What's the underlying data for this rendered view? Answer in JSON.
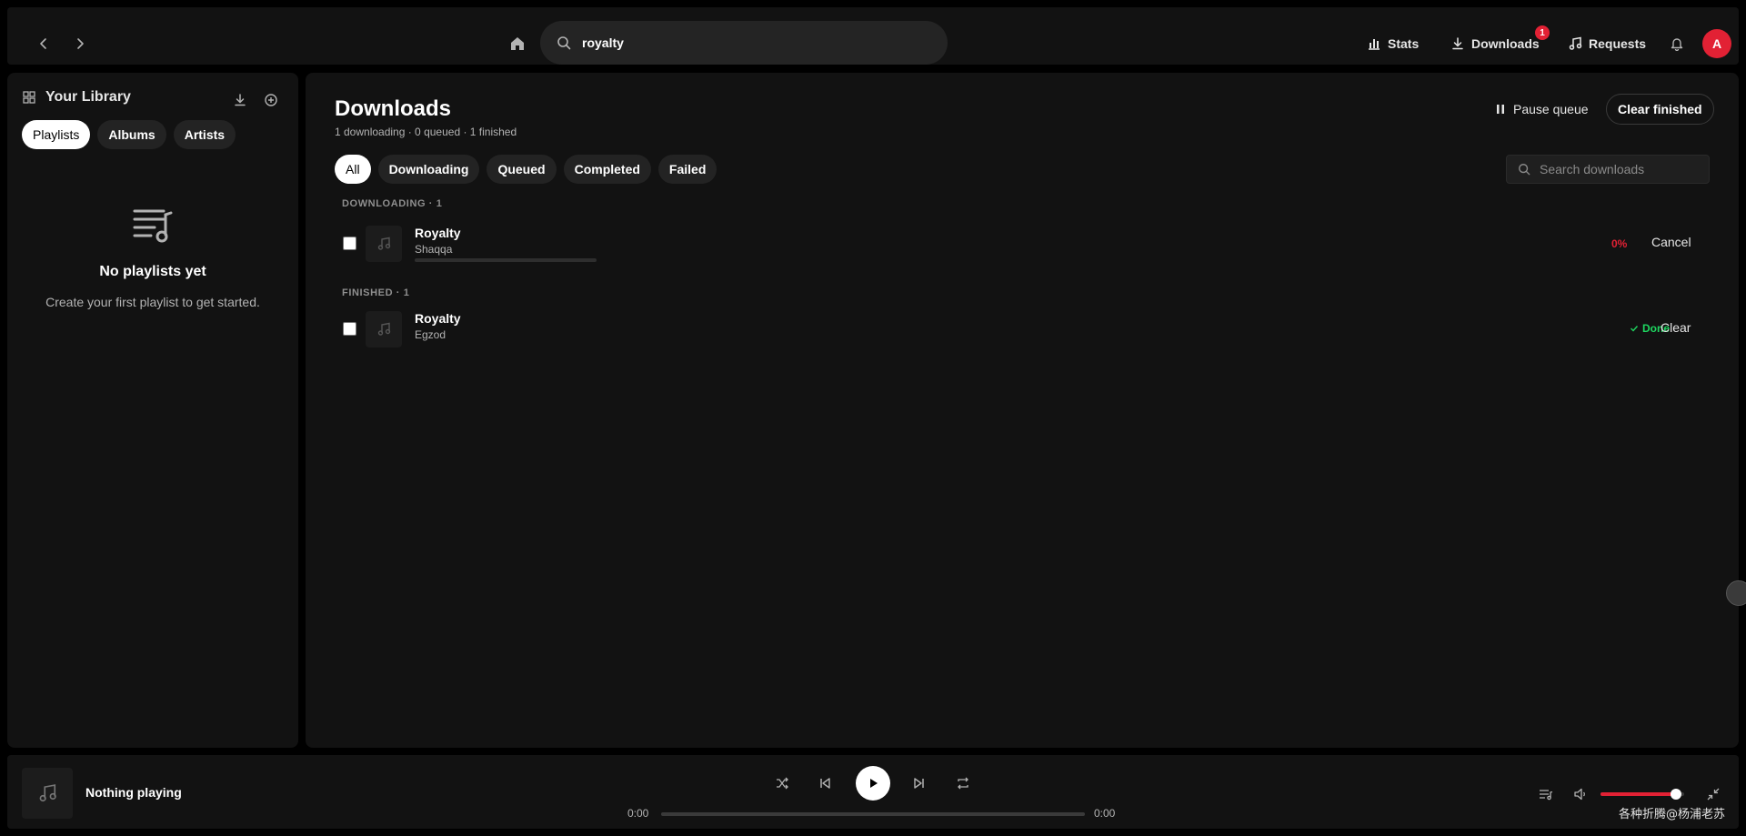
{
  "topbar": {
    "search_value": "royalty",
    "stats_label": "Stats",
    "downloads_label": "Downloads",
    "downloads_badge": "1",
    "requests_label": "Requests",
    "avatar_initial": "A"
  },
  "sidebar": {
    "title": "Your Library",
    "pills": [
      "Playlists",
      "Albums",
      "Artists"
    ],
    "active_pill": "Playlists",
    "empty_title": "No playlists yet",
    "empty_subtitle": "Create your first playlist to get started."
  },
  "main": {
    "title": "Downloads",
    "summary": "1 downloading · 0 queued · 1 finished",
    "pause_label": "Pause queue",
    "clear_finished_label": "Clear finished",
    "filters": [
      "All",
      "Downloading",
      "Queued",
      "Completed",
      "Failed"
    ],
    "active_filter": "All",
    "search_placeholder": "Search downloads",
    "sections": [
      {
        "label": "DOWNLOADING · 1",
        "items": [
          {
            "title": "Royalty",
            "artist": "Shaqqa",
            "progress_percent": 0,
            "status": "0%",
            "action": "Cancel"
          }
        ]
      },
      {
        "label": "FINISHED · 1",
        "items": [
          {
            "title": "Royalty",
            "artist": "Egzod",
            "status": "Done",
            "action": "Clear"
          }
        ]
      }
    ]
  },
  "player": {
    "now_playing": "Nothing playing",
    "time_elapsed": "0:00",
    "time_total": "0:00",
    "volume_fraction": 0.9
  },
  "watermark": "各种折腾@杨浦老苏",
  "colors": {
    "accent": "#e22134",
    "done": "#1ed760",
    "surface": "#121212",
    "background": "#000000"
  },
  "icons": [
    "chevron-left-icon",
    "chevron-right-icon",
    "home-icon",
    "search-icon",
    "bar-chart-icon",
    "download-icon",
    "music-note-icon",
    "bell-icon",
    "grid-icon",
    "plus-circle-icon",
    "playlist-icon",
    "pause-icon",
    "check-icon",
    "shuffle-icon",
    "previous-icon",
    "play-icon",
    "next-icon",
    "repeat-icon",
    "queue-icon",
    "volume-icon",
    "minimize-icon"
  ]
}
